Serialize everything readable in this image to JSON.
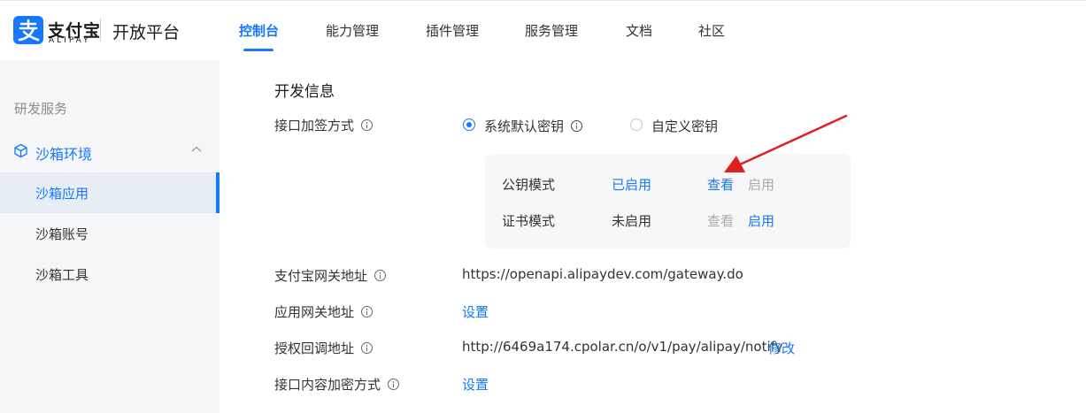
{
  "header": {
    "logo_name": "支付宝",
    "logo_sub": "ALIPAY",
    "platform": "开放平台",
    "nav": [
      "控制台",
      "能力管理",
      "插件管理",
      "服务管理",
      "文档",
      "社区"
    ],
    "active_nav": "控制台",
    "brand_color": "#1677ff"
  },
  "sidebar": {
    "group_title": "研发服务",
    "section": {
      "label": "沙箱环境",
      "icon": "cube-icon",
      "expanded": true
    },
    "items": [
      "沙箱应用",
      "沙箱账号",
      "沙箱工具"
    ],
    "active_item": "沙箱应用"
  },
  "main": {
    "section_title": "开发信息",
    "sign_method": {
      "label": "接口加签方式",
      "options": [
        "系统默认密钥",
        "自定义密钥"
      ],
      "selected": "系统默认密钥"
    },
    "key_modes": [
      {
        "name": "公钥模式",
        "status": "已启用",
        "view": "查看",
        "enable": "启用"
      },
      {
        "name": "证书模式",
        "status": "未启用",
        "view": "查看",
        "enable": "启用"
      }
    ],
    "gateway": {
      "label": "支付宝网关地址",
      "value": "https://openapi.alipaydev.com/gateway.do"
    },
    "app_gateway": {
      "label": "应用网关地址",
      "action": "设置"
    },
    "callback": {
      "label": "授权回调地址",
      "value": "http://6469a174.cpolar.cn/o/v1/pay/alipay/notify",
      "action": "修改"
    },
    "encrypt": {
      "label": "接口内容加密方式",
      "action": "设置"
    }
  }
}
